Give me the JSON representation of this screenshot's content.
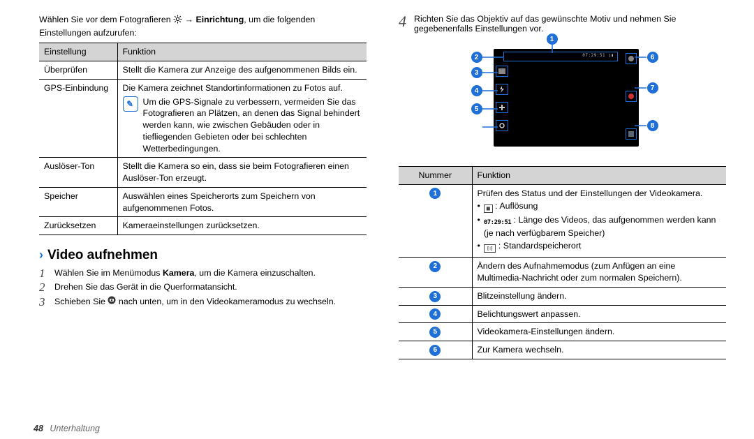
{
  "left": {
    "intro_a": "Wählen Sie vor dem Fotografieren ",
    "intro_b": " → ",
    "intro_bold": "Einrichtung",
    "intro_c": ", um die folgenden Einstellungen aufzurufen:",
    "th1": "Einstellung",
    "th2": "Funktion",
    "rows": {
      "r1c1": "Überprüfen",
      "r1c2": "Stellt die Kamera zur Anzeige des aufgenommenen Bilds ein.",
      "r2c1": "GPS-Einbindung",
      "r2c2a": "Die Kamera zeichnet Standortinformationen zu Fotos auf.",
      "r2c2b": "Um die GPS-Signale zu verbessern, vermeiden Sie das Fotografieren an Plätzen, an denen das Signal behindert werden kann, wie zwischen Gebäuden oder in tiefliegenden Gebieten oder bei schlechten Wetterbedingungen.",
      "r3c1": "Auslöser-Ton",
      "r3c2": "Stellt die Kamera so ein, dass sie beim Fotografieren einen Auslöser-Ton erzeugt.",
      "r4c1": "Speicher",
      "r4c2": "Auswählen eines Speicherorts zum Speichern von aufgenommenen Fotos.",
      "r5c1": "Zurücksetzen",
      "r5c2": "Kameraeinstellungen zurücksetzen."
    },
    "section": "Video aufnehmen",
    "steps": {
      "s1a": "Wählen Sie im Menümodus ",
      "s1b": "Kamera",
      "s1c": ", um die Kamera einzuschalten.",
      "s2": "Drehen Sie das Gerät in die Querformatansicht.",
      "s3a": "Schieben Sie ",
      "s3b": " nach unten, um in den Videokameramodus zu wechseln."
    }
  },
  "right": {
    "step4": "Richten Sie das Objektiv auf das gewünschte Motiv und nehmen Sie gegebenenfalls Einstellungen vor.",
    "diagram_topbar": "07:29:51 ▯▮",
    "th1": "Nummer",
    "th2": "Funktion",
    "rows": {
      "r1a": "Prüfen des Status und der Einstellungen der Videokamera.",
      "r1b": " : Auflösung",
      "r1c_pre": " : Länge des Videos, das aufgenommen werden kann (je nach verfügbarem Speicher)",
      "r1c_icon": "07:29:51",
      "r1d": " : Standardspeicherort",
      "r2": "Ändern des Aufnahmemodus (zum Anfügen an eine Multimedia-Nachricht oder zum normalen Speichern).",
      "r3": "Blitzeinstellung ändern.",
      "r4": "Belichtungswert anpassen.",
      "r5": "Videokamera-Einstellungen ändern.",
      "r6": "Zur Kamera wechseln."
    }
  },
  "footer": {
    "page": "48",
    "section": "Unterhaltung"
  }
}
